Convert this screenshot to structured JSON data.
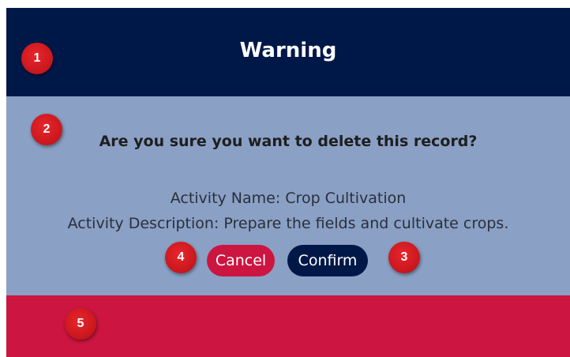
{
  "dialog": {
    "title": "Warning",
    "question": "Are you sure you want to delete this record?",
    "activity_name": "Activity Name: Crop Cultivation",
    "activity_description": "Activity Description: Prepare the fields and cultivate crops.",
    "cancel_label": "Cancel",
    "confirm_label": "Confirm"
  },
  "markers": [
    "1",
    "2",
    "3",
    "4",
    "5"
  ],
  "colors": {
    "header": "#001848",
    "body": "#8aa0c5",
    "footer": "#cc1540",
    "cancel_button": "#cc1540",
    "confirm_button": "#001848",
    "marker": "#d41e24"
  }
}
